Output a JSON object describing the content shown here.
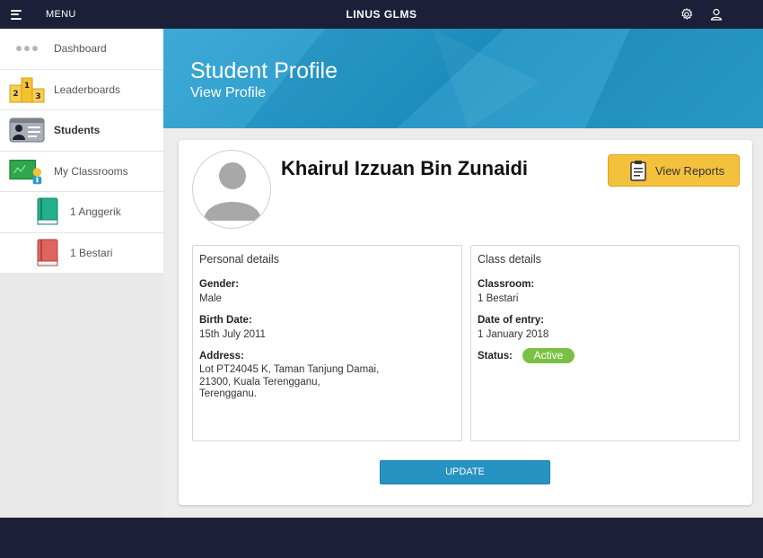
{
  "topbar": {
    "menu_label": "MENU",
    "app_title": "LINUS GLMS"
  },
  "sidebar": {
    "items": [
      {
        "label": "Dashboard",
        "icon": "dots-icon"
      },
      {
        "label": "Leaderboards",
        "icon": "podium-icon"
      },
      {
        "label": "Students",
        "icon": "id-card-icon",
        "active": true
      },
      {
        "label": "My Classrooms",
        "icon": "classroom-icon"
      },
      {
        "label": "1 Anggerik",
        "icon": "green-book-icon"
      },
      {
        "label": "1 Bestari",
        "icon": "red-book-icon"
      }
    ]
  },
  "banner": {
    "title": "Student Profile",
    "subtitle": "View Profile"
  },
  "profile": {
    "name": "Khairul Izzuan Bin Zunaidi",
    "view_reports_label": "View Reports"
  },
  "personal": {
    "title": "Personal details",
    "gender_label": "Gender:",
    "gender": "Male",
    "birth_label": "Birth Date:",
    "birth": "15th July 2011",
    "address_label": "Address:",
    "address": "Lot PT24045 K, Taman Tanjung Damai,\n21300, Kuala Terengganu,\nTerengganu."
  },
  "class": {
    "title": "Class details",
    "classroom_label": "Classroom:",
    "classroom": "1 Bestari",
    "entry_label": "Date of entry:",
    "entry": "1 January 2018",
    "status_label": "Status:",
    "status": "Active"
  },
  "actions": {
    "update_label": "UPDATE"
  },
  "colors": {
    "topbar": "#1b2038",
    "banner": "#2a9ccb",
    "reports_button": "#f3c13c",
    "status_active": "#7ac143",
    "update_button": "#2693c2"
  }
}
